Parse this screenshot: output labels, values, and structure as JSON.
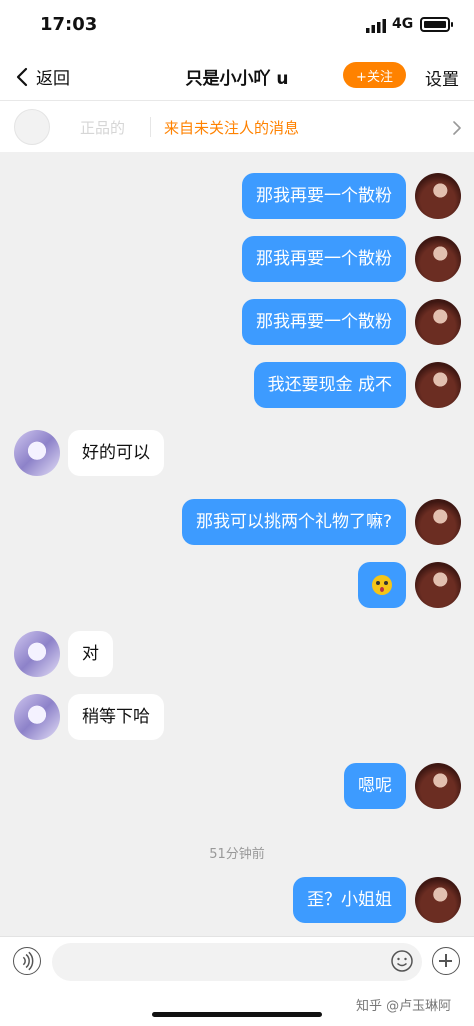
{
  "status_bar": {
    "time": "17:03",
    "network": "4G"
  },
  "nav": {
    "back_label": "返回",
    "title": "只是小小吖 u",
    "follow_label": "+关注",
    "settings_label": "设置"
  },
  "notice": {
    "faded_name": "正品的",
    "text": "来自未关注人的消息"
  },
  "messages": [
    {
      "from": "me",
      "text": "那我再要一个散粉"
    },
    {
      "from": "me",
      "text": "那我再要一个散粉"
    },
    {
      "from": "me",
      "text": "那我再要一个散粉"
    },
    {
      "from": "me",
      "text": "我还要现金 成不"
    },
    {
      "from": "them",
      "text": "好的可以"
    },
    {
      "from": "me",
      "text": "那我可以挑两个礼物了嘛?"
    },
    {
      "from": "me",
      "emoji": "flushed-face-emoji"
    },
    {
      "from": "them",
      "text": "对"
    },
    {
      "from": "them",
      "text": "稍等下哈"
    },
    {
      "from": "me",
      "text": "嗯呢"
    },
    {
      "from": "me",
      "text": "歪？小姐姐"
    }
  ],
  "time_divider": "51分钟前",
  "watermark": "知乎 @卢玉琳阿",
  "icons": {
    "back": "chevron-left-icon",
    "notice_arrow": "chevron-right-icon",
    "voice": "voice-icon",
    "emoji": "smiley-icon",
    "plus": "plus-icon"
  },
  "colors": {
    "accent_orange": "#ff8200",
    "outgoing_bubble": "#3d9bff",
    "chat_bg": "#f0f0f0"
  }
}
